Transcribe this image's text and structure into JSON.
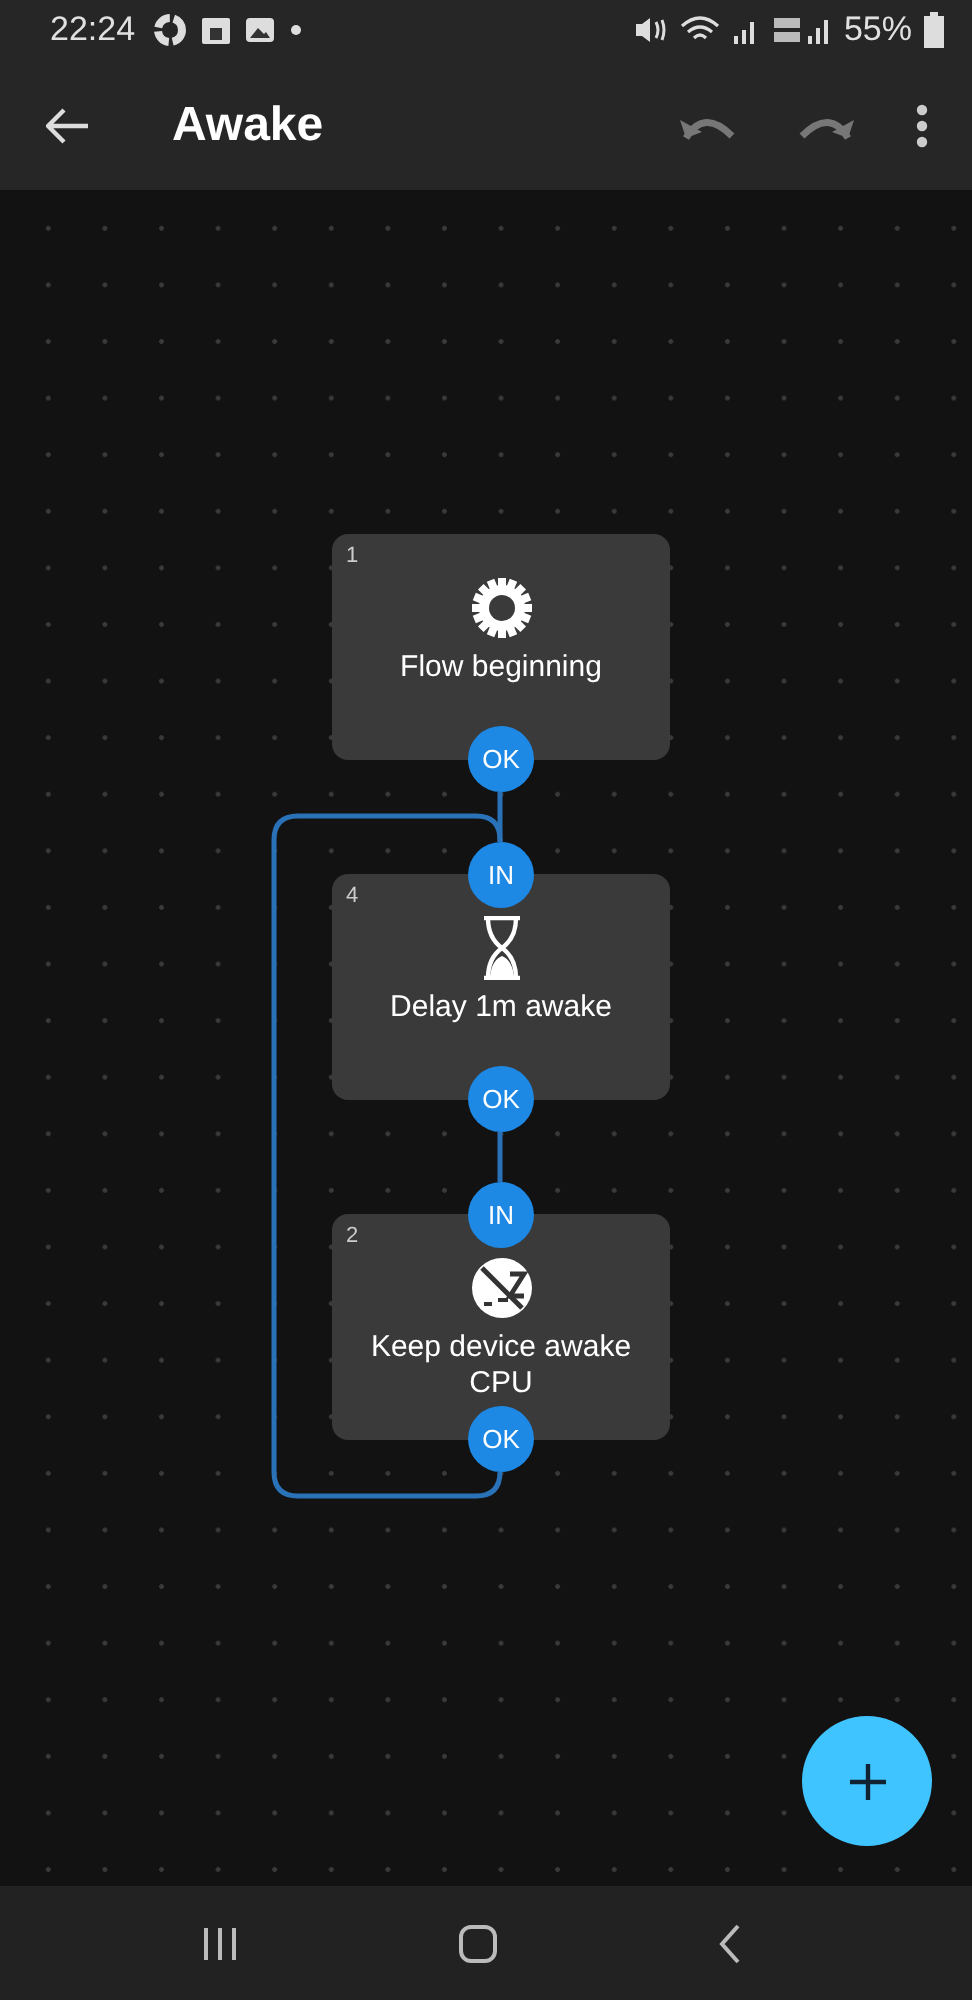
{
  "status_bar": {
    "time": "22:24",
    "battery": "55%"
  },
  "toolbar": {
    "title": "Awake"
  },
  "nodes": [
    {
      "number": "1",
      "label": "Flow beginning",
      "kind": "trigger",
      "ports": [
        {
          "label": "OK",
          "kind": "output"
        }
      ]
    },
    {
      "number": "4",
      "label": "Delay 1m awake",
      "kind": "delay",
      "ports": [
        {
          "label": "IN",
          "kind": "input"
        },
        {
          "label": "OK",
          "kind": "output"
        }
      ]
    },
    {
      "number": "2",
      "label": "Keep device awake CPU",
      "kind": "awake",
      "ports": [
        {
          "label": "IN",
          "kind": "input"
        },
        {
          "label": "OK",
          "kind": "output"
        }
      ]
    }
  ]
}
